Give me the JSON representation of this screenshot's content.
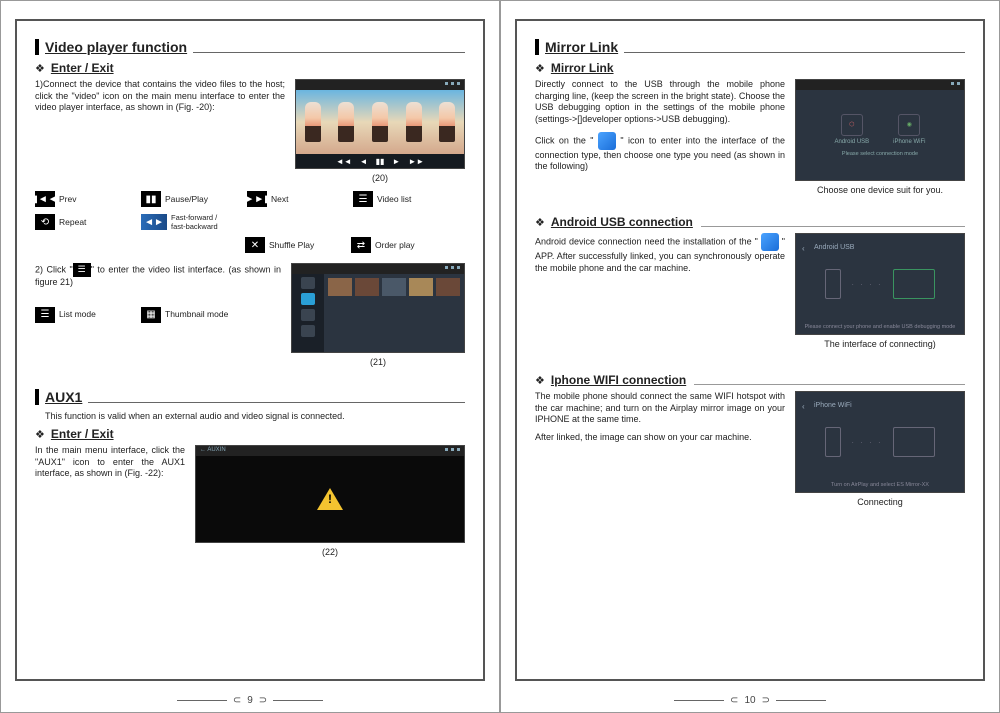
{
  "page_left_num": "9",
  "page_right_num": "10",
  "left": {
    "section1_title": "Video player function",
    "sub1": "Enter / Exit",
    "para1": "1)Connect the device that contains the video files to the host; click the \"video\" icon on the main menu interface to enter the video player interface, as shown in (Fig. -20):",
    "fig20_cap": "(20)",
    "icons": {
      "prev": "Prev",
      "pause": "Pause/Play",
      "next": "Next",
      "list": "Video list",
      "repeat": "Repeat",
      "ff": "Fast-forward / fast-backward",
      "shuffle": "Shuffle Play",
      "order": "Order play"
    },
    "para2a": "2) Click \"",
    "para2b": "\" to enter the video list interface. (as shown in figure 21)",
    "listmode": "List mode",
    "thumbmode": "Thumbnail mode",
    "fig21_cap": "(21)",
    "section2_title": "AUX1",
    "aux_desc": "This function is valid when an external audio and video signal is connected.",
    "sub2": "Enter / Exit",
    "aux_para": "In the main menu interface, click the \"AUX1\" icon to enter the AUX1 interface, as shown in (Fig. -22):",
    "fig22_cap": "(22)"
  },
  "right": {
    "section_title": "Mirror Link",
    "sub1": "Mirror Link",
    "para1": "Directly connect to the USB through the mobile phone charging line, (keep the screen in the bright state). Choose the USB debugging option in the settings of the mobile phone (settings->[]developer options->USB debugging).",
    "para2a": "Click on the \"",
    "para2b": "\" icon to enter into the interface of the connection type, then choose one type you need (as shown in the following)",
    "mirror_opt1": "Android USB",
    "mirror_opt2": "iPhone WiFi",
    "mirror_hint": "Please select connection mode",
    "cap1": "Choose one device suit for you.",
    "sub2": "Android USB connection",
    "android_a": "Android device connection need the installation of the \"",
    "android_b": "\" APP. After successfully linked, you can synchronously operate the mobile phone and the car machine.",
    "android_title": "Android USB",
    "android_footer": "Please connect your phone and enable USB debugging mode",
    "cap2": "The interface of connecting)",
    "sub3": "Iphone WIFI connection",
    "iphone_p1": "The mobile phone should connect the same WIFI hotspot with the car machine; and turn on the Airplay mirror image on your IPHONE at the same time.",
    "iphone_p2": "After linked, the image can show on your car machine.",
    "iphone_title": "iPhone WiFi",
    "iphone_footer": "Turn on AirPlay and select ES Mirror-XX",
    "cap3": "Connecting"
  }
}
